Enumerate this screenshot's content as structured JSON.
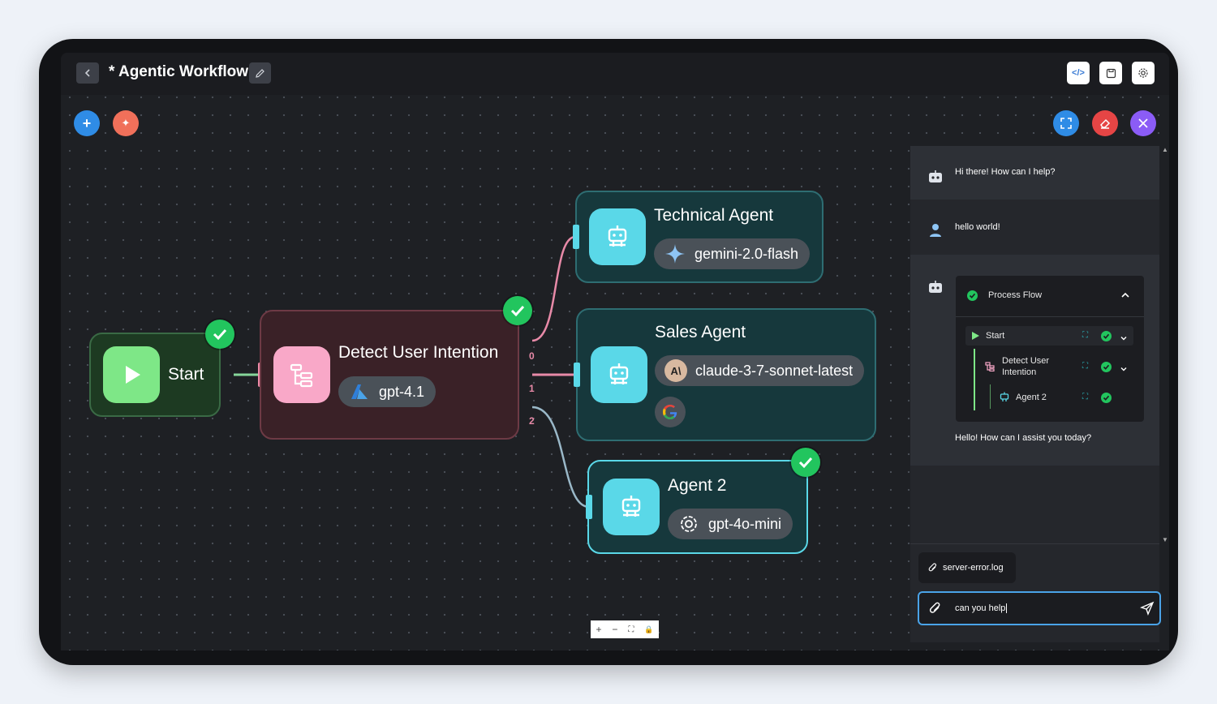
{
  "header": {
    "back_icon": "chevron-left-icon",
    "title": "* Agentic Workflow",
    "edit_icon": "pencil-icon",
    "tools": [
      "code-icon",
      "save-icon",
      "gear-icon"
    ]
  },
  "canvas_actions": {
    "add_icon": "plus-icon",
    "magic_icon": "sparkle-icon",
    "fit_icon": "expand-icon",
    "erase_icon": "eraser-icon",
    "close_icon": "close-icon"
  },
  "nodes": {
    "start": {
      "label": "Start",
      "color": "#7ee787"
    },
    "detect": {
      "label": "Detect User Intention",
      "model": "gpt-4.1",
      "color": "#f9a8c8"
    },
    "technical": {
      "label": "Technical Agent",
      "model": "gemini-2.0-flash",
      "color": "#5ad8e8"
    },
    "sales": {
      "label": "Sales Agent",
      "model": "claude-3-7-sonnet-latest",
      "color": "#5ad8e8"
    },
    "agent2": {
      "label": "Agent 2",
      "model": "gpt-4o-mini",
      "color": "#5ad8e8"
    }
  },
  "ports": {
    "out0": "0",
    "out1": "1",
    "out2": "2"
  },
  "chat": {
    "messages": [
      {
        "role": "bot",
        "text": "Hi there! How can I help?"
      },
      {
        "role": "user",
        "text": "hello world!"
      },
      {
        "role": "bot",
        "text": "Hello! How can I assist you today?"
      }
    ],
    "process_flow": {
      "title": "Process Flow",
      "steps": [
        "Start",
        "Detect User Intention",
        "Agent 2"
      ]
    },
    "attachment": "server-error.log",
    "input_value": "can you help"
  },
  "zoom_controls": [
    "+",
    "−",
    "⛶",
    "🔒"
  ]
}
